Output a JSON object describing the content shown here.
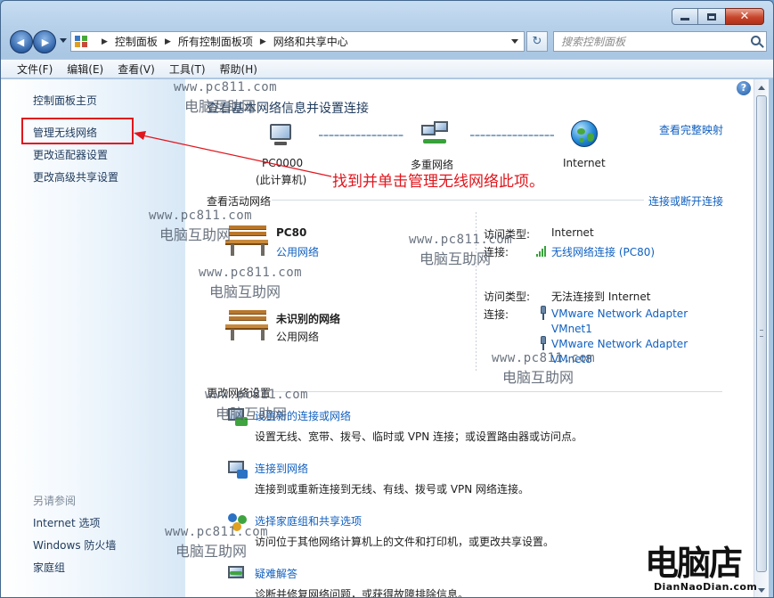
{
  "window": {
    "caption_close_glyph": "✕"
  },
  "nav": {
    "back_glyph": "◀",
    "forward_glyph": "▶",
    "breadcrumb": [
      "控制面板",
      "所有控制面板项",
      "网络和共享中心"
    ],
    "breadcrumb_separator": "▶",
    "refresh_glyph": "↻",
    "search_placeholder": "搜索控制面板"
  },
  "menu": [
    "文件(F)",
    "编辑(E)",
    "查看(V)",
    "工具(T)",
    "帮助(H)"
  ],
  "sidebar": {
    "links": [
      "控制面板主页",
      "管理无线网络",
      "更改适配器设置",
      "更改高级共享设置"
    ],
    "see_also_label": "另请参阅",
    "see_also": [
      "Internet 选项",
      "Windows 防火墙",
      "家庭组"
    ]
  },
  "main": {
    "help_glyph": "?",
    "title": "查看基本网络信息并设置连接",
    "view_full_map": "查看完整映射",
    "map": {
      "computer_name": "PC0000",
      "computer_sub": "(此计算机)",
      "middle": "多重网络",
      "right": "Internet"
    },
    "active_networks_header": "查看活动网络",
    "connect_disconnect": "连接或断开连接",
    "networks": [
      {
        "name": "PC80",
        "type": "公用网络",
        "type_is_link": true,
        "access_label": "访问类型:",
        "access_value": "Internet",
        "conn_label": "连接:",
        "connections": [
          "无线网络连接 (PC80)"
        ]
      },
      {
        "name": "未识别的网络",
        "type": "公用网络",
        "type_is_link": false,
        "access_label": "访问类型:",
        "access_value": "无法连接到 Internet",
        "conn_label": "连接:",
        "connections": [
          "VMware Network Adapter VMnet1",
          "VMware Network Adapter VMnet8"
        ]
      }
    ],
    "change_settings_header": "更改网络设置",
    "tasks": [
      {
        "title": "设置新的连接或网络",
        "desc": "设置无线、宽带、拨号、临时或 VPN 连接；或设置路由器或访问点。"
      },
      {
        "title": "连接到网络",
        "desc": "连接到或重新连接到无线、有线、拨号或 VPN 网络连接。"
      },
      {
        "title": "选择家庭组和共享选项",
        "desc": "访问位于其他网络计算机上的文件和打印机，或更改共享设置。"
      },
      {
        "title": "疑难解答",
        "desc": "诊断并修复网络问题，或获得故障排除信息。"
      }
    ]
  },
  "annotation": {
    "text": "找到并单击管理无线网络此项。",
    "color": "#e0161d"
  },
  "watermark": {
    "url": "www.pc811.com",
    "cn": "电脑互助网"
  },
  "logo": {
    "cn": "电脑店",
    "en": "DianNaoDian.com"
  }
}
